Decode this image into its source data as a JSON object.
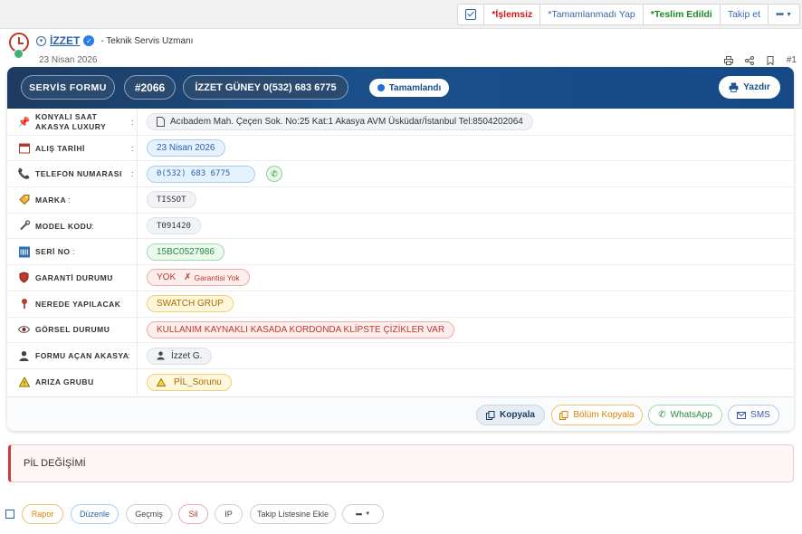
{
  "toolbar": {
    "unprocessed": "*İşlemsiz",
    "mark_incomplete": "*Tamamlanmadı Yap",
    "delivered": "*Teslim Edildi",
    "follow": "Takip et",
    "more": "•••"
  },
  "post": {
    "author": "İZZET",
    "role": "- Teknik Servis Uzmanı",
    "date": "23 Nisan 2026",
    "index": "#1"
  },
  "form": {
    "title": "SERVİS FORMU",
    "number": "#2066",
    "customer": "İZZET GÜNEY 0(532) 683 6775",
    "status": "Tamamlandı",
    "print": "Yazdır"
  },
  "rows": [
    {
      "label": "KONYALI SAAT AKASYA LUXURY",
      "colon": ":",
      "value": "Acıbadem Mah. Çeçen Sok. No:25 Kat:1 Akasya AVM Üsküdar/İstanbul Tel:8504202064"
    },
    {
      "label": "ALIŞ TARİHİ",
      "colon": ":",
      "value": "23 Nisan 2026"
    },
    {
      "label": "TELEFON NUMARASI",
      "colon": ":",
      "value": "0(532) 683 6775"
    },
    {
      "label": "MARKA",
      "colon": ":",
      "value": "TISSOT"
    },
    {
      "label": "MODEL KODU",
      "colon": ":",
      "value": "T091420"
    },
    {
      "label": "SERİ NO",
      "colon": ":",
      "value": "15BC0527986"
    },
    {
      "label": "GARANTİ DURUMU",
      "colon": ":",
      "value": "YOK",
      "extra": "Garantisi Yok"
    },
    {
      "label": "NEREDE YAPILACAK",
      "colon": ":",
      "value": "SWATCH GRUP"
    },
    {
      "label": "GÖRSEL DURUMU",
      "colon": ":",
      "value": "KULLANIM KAYNAKLI KASADA KORDONDA KLİPSTE ÇİZİKLER VAR"
    },
    {
      "label": "FORMU AÇAN AKASYA",
      "colon": ":",
      "value": "İzzet G."
    },
    {
      "label": "ARIZA GRUBU",
      "colon": ":",
      "value": "PİL_Sorunu"
    }
  ],
  "footer": {
    "copy": "Kopyala",
    "section_copy": "Bölüm Kopyala",
    "whatsapp": "WhatsApp",
    "sms": "SMS"
  },
  "note": "PİL DEĞİŞİMİ",
  "actions": {
    "report": "Rapor",
    "edit": "Düzenle",
    "history": "Geçmiş",
    "delete": "Sil",
    "ip": "IP",
    "add_watch": "Takip Listesine Ekle",
    "more": "•••"
  },
  "colors": {
    "header_bg": "#1a4f8a",
    "accent_blue": "#2b62b0",
    "danger": "#d01818",
    "success": "#1f8a1f"
  }
}
